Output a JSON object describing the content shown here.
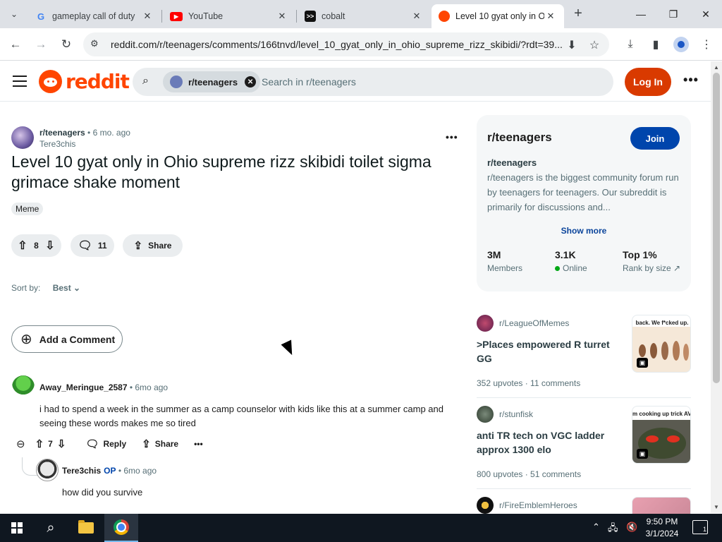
{
  "browser": {
    "tabs": [
      {
        "title": "gameplay call of duty ",
        "favicon": "google-icon",
        "active": false
      },
      {
        "title": "YouTube",
        "favicon": "youtube-icon",
        "active": false
      },
      {
        "title": "cobalt",
        "favicon": "cobalt-icon",
        "active": false
      },
      {
        "title": "Level 10 gyat only in O",
        "favicon": "reddit-icon",
        "active": true
      }
    ],
    "url": "reddit.com/r/teenagers/comments/166tnvd/level_10_gyat_only_in_ohio_supreme_rizz_skibidi/?rdt=39...",
    "icons": {
      "back": "←",
      "forward": "→",
      "reload": "↻",
      "tune": "⚙",
      "install": "⬇",
      "star": "☆",
      "download": "⤓",
      "sidepanel": "▮",
      "menu": "⋮",
      "newtab": "+",
      "minimize": "—",
      "restore": "❐",
      "close": "✕",
      "close_tab": "✕",
      "tab_list": "⌄"
    }
  },
  "reddit": {
    "header": {
      "wordmark": "reddit",
      "search_chip": "r/teenagers",
      "search_placeholder": "Search in r/teenagers",
      "login": "Log In",
      "more": "•••"
    },
    "post": {
      "subreddit": "r/teenagers",
      "time": " • 6 mo. ago",
      "author": "Tere3chis",
      "title": "Level 10 gyat only in Ohio supreme rizz skibidi toilet sigma grimace shake moment",
      "flair": "Meme",
      "score": "8",
      "comments": "11",
      "share": "Share",
      "more": "•••"
    },
    "sort": {
      "label": "Sort by:",
      "value": "Best ⌄"
    },
    "add_comment": "Add a Comment",
    "comments": [
      {
        "author": "Away_Meringue_2587",
        "time": " • 6mo ago",
        "body": "i had to spend a week in the summer as a camp counselor with kids like this at a summer camp and seeing these words makes me so tired",
        "score": "7",
        "reply": "Reply",
        "share": "Share",
        "more": "•••"
      },
      {
        "author": "Tere3chis",
        "op": "OP",
        "time": " • 6mo ago",
        "body": "how did you survive"
      }
    ],
    "sidebar": {
      "title": "r/teenagers",
      "join": "Join",
      "name": "r/teenagers",
      "description": "r/teenagers is the biggest community forum run by teenagers for teenagers. Our subreddit is primarily for discussions and...",
      "show_more": "Show more",
      "stats": [
        {
          "value": "3M",
          "label": "Members"
        },
        {
          "value": "3.1K",
          "label": "Online"
        },
        {
          "value": "Top 1%",
          "label": "Rank by size ↗"
        }
      ]
    },
    "feed": [
      {
        "subreddit": "r/LeagueOfMemes",
        "title": ">Places empowered R turret GG",
        "stats": "352 upvotes  ·  11 comments",
        "thumb_caption": "back. We f*cked up."
      },
      {
        "subreddit": "r/stunfisk",
        "title": "anti TR tech on VGC ladder approx 1300 elo",
        "stats": "800 upvotes  ·  51 comments",
        "thumb_caption": "m cooking up trick AV grimmsnar"
      },
      {
        "subreddit": "r/FireEmblemHeroes"
      }
    ]
  },
  "taskbar": {
    "time": "9:50 PM",
    "date": "3/1/2024",
    "notifications": "1"
  }
}
